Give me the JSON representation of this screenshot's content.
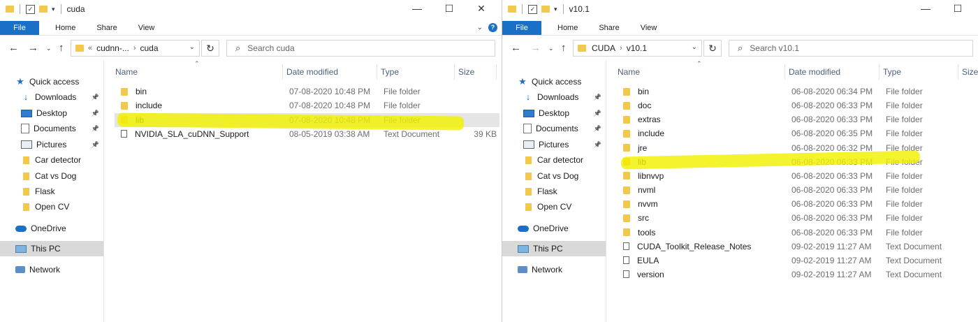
{
  "left": {
    "title": "cuda",
    "ribbon_tabs": [
      "File",
      "Home",
      "Share",
      "View"
    ],
    "breadcrumb": [
      "«",
      "cudnn-...",
      "›",
      "cuda"
    ],
    "search_placeholder": "Search cuda",
    "columns": [
      "Name",
      "Date modified",
      "Type",
      "Size"
    ],
    "rows": [
      {
        "name": "bin",
        "date": "07-08-2020 10:48 PM",
        "type": "File folder",
        "size": "",
        "icon": "folder-icon"
      },
      {
        "name": "include",
        "date": "07-08-2020 10:48 PM",
        "type": "File folder",
        "size": "",
        "icon": "folder-icon"
      },
      {
        "name": "lib",
        "date": "07-08-2020 10:48 PM",
        "type": "File folder",
        "size": "",
        "icon": "folder-icon"
      },
      {
        "name": "NVIDIA_SLA_cuDNN_Support",
        "date": "08-05-2019 03:38 AM",
        "type": "Text Document",
        "size": "39 KB",
        "icon": "document-icon"
      }
    ]
  },
  "right": {
    "title": "v10.1",
    "ribbon_tabs": [
      "File",
      "Home",
      "Share",
      "View"
    ],
    "breadcrumb": [
      "CUDA",
      "›",
      "v10.1"
    ],
    "search_placeholder": "Search v10.1",
    "columns": [
      "Name",
      "Date modified",
      "Type",
      "Size"
    ],
    "rows": [
      {
        "name": "bin",
        "date": "06-08-2020 06:34 PM",
        "type": "File folder",
        "icon": "folder-icon"
      },
      {
        "name": "doc",
        "date": "06-08-2020 06:33 PM",
        "type": "File folder",
        "icon": "folder-icon"
      },
      {
        "name": "extras",
        "date": "06-08-2020 06:33 PM",
        "type": "File folder",
        "icon": "folder-icon"
      },
      {
        "name": "include",
        "date": "06-08-2020 06:35 PM",
        "type": "File folder",
        "icon": "folder-icon"
      },
      {
        "name": "jre",
        "date": "06-08-2020 06:32 PM",
        "type": "File folder",
        "icon": "folder-icon"
      },
      {
        "name": "lib",
        "date": "06-08-2020 06:33 PM",
        "type": "File folder",
        "icon": "folder-icon"
      },
      {
        "name": "libnvvp",
        "date": "06-08-2020 06:33 PM",
        "type": "File folder",
        "icon": "folder-icon"
      },
      {
        "name": "nvml",
        "date": "06-08-2020 06:33 PM",
        "type": "File folder",
        "icon": "folder-icon"
      },
      {
        "name": "nvvm",
        "date": "06-08-2020 06:33 PM",
        "type": "File folder",
        "icon": "folder-icon"
      },
      {
        "name": "src",
        "date": "06-08-2020 06:33 PM",
        "type": "File folder",
        "icon": "folder-icon"
      },
      {
        "name": "tools",
        "date": "06-08-2020 06:33 PM",
        "type": "File folder",
        "icon": "folder-icon"
      },
      {
        "name": "CUDA_Toolkit_Release_Notes",
        "date": "09-02-2019 11:27 AM",
        "type": "Text Document",
        "icon": "document-icon"
      },
      {
        "name": "EULA",
        "date": "09-02-2019 11:27 AM",
        "type": "Text Document",
        "icon": "document-icon"
      },
      {
        "name": "version",
        "date": "09-02-2019 11:27 AM",
        "type": "Text Document",
        "icon": "document-icon"
      }
    ]
  },
  "sidebar": [
    {
      "label": "Quick access",
      "icon": "star-icon",
      "pinned": false
    },
    {
      "label": "Downloads",
      "icon": "download-icon",
      "pinned": true
    },
    {
      "label": "Desktop",
      "icon": "desktop-icon",
      "pinned": true
    },
    {
      "label": "Documents",
      "icon": "documents-icon",
      "pinned": true
    },
    {
      "label": "Pictures",
      "icon": "pictures-icon",
      "pinned": true
    },
    {
      "label": "Car detector",
      "icon": "folder-icon",
      "pinned": false
    },
    {
      "label": "Cat vs Dog",
      "icon": "folder-icon",
      "pinned": false
    },
    {
      "label": "Flask",
      "icon": "folder-icon",
      "pinned": false
    },
    {
      "label": "Open CV",
      "icon": "folder-icon",
      "pinned": false
    },
    {
      "label": "OneDrive",
      "icon": "cloud-icon",
      "pinned": false
    },
    {
      "label": "This PC",
      "icon": "pc-icon",
      "pinned": false,
      "selected": true
    },
    {
      "label": "Network",
      "icon": "network-icon",
      "pinned": false
    }
  ],
  "colors": {
    "accent": "#1a6fc7",
    "folder": "#f2c94c",
    "highlight": "#f0f000"
  }
}
